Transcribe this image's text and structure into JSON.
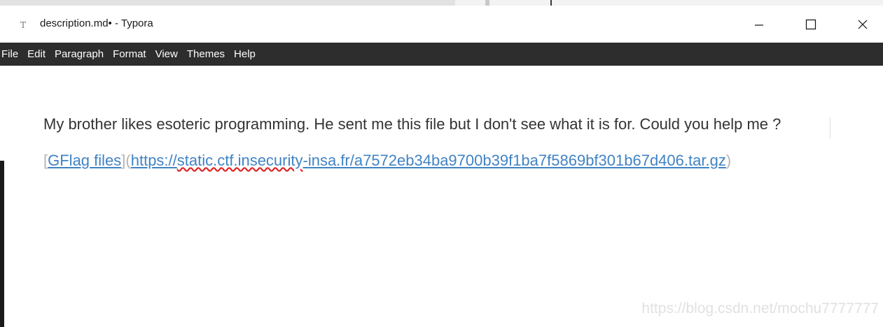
{
  "window": {
    "title": "description.md• - Typora",
    "app_icon": "typora-icon",
    "controls": {
      "minimize": "minimize-icon",
      "maximize": "maximize-icon",
      "close": "close-icon"
    }
  },
  "menu": {
    "items": [
      "File",
      "Edit",
      "Paragraph",
      "Format",
      "View",
      "Themes",
      "Help"
    ]
  },
  "document": {
    "paragraph": "My brother likes esoteric programming. He sent me this file but I don't see what it is for. Could you help me ?",
    "link": {
      "open_bracket": "[",
      "text": "GFlag files",
      "close_bracket_open_paren": "](",
      "url_prefix": "https://",
      "url_misspelled": "static.ctf.insecurity",
      "url_rest": "-insa.fr/a7572eb34ba9700b39f1ba7f5869bf301b67d406.tar.gz",
      "close_paren": ")"
    }
  },
  "watermark": "https://blog.csdn.net/mochu7777777",
  "colors": {
    "menubar_bg": "#2d2d2d",
    "link": "#4183c4",
    "text": "#333333",
    "syntax": "#b5b5b5"
  }
}
